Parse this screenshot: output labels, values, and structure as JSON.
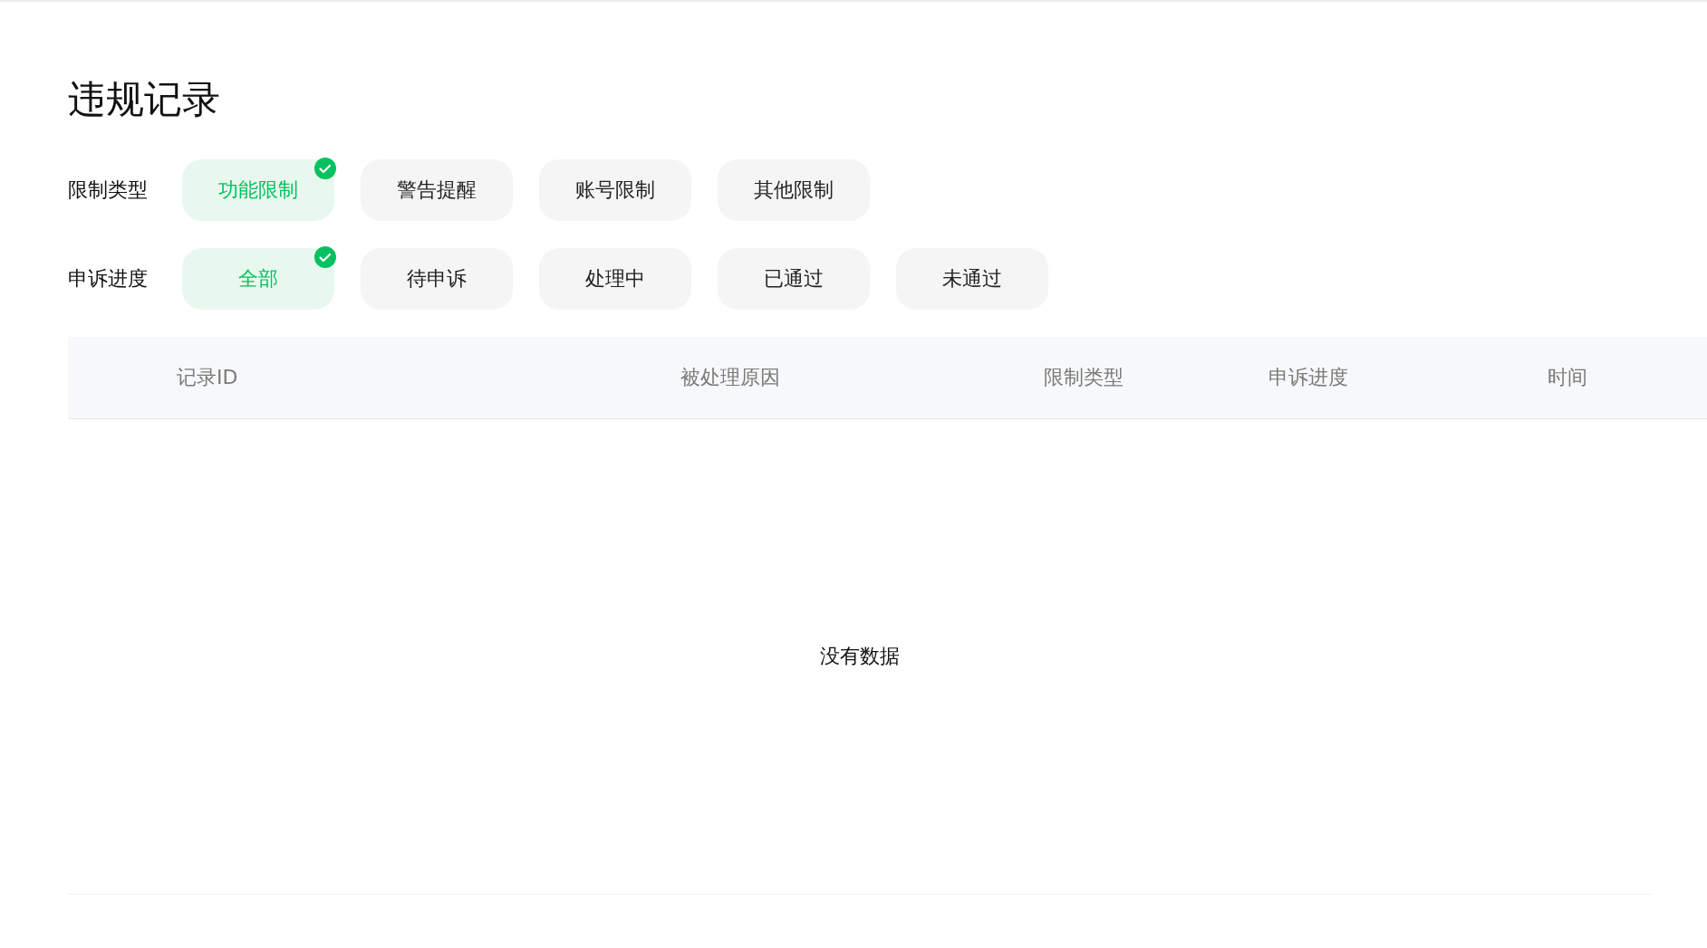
{
  "title": "违规记录",
  "filters": [
    {
      "label": "限制类型",
      "options": [
        {
          "label": "功能限制",
          "selected": true
        },
        {
          "label": "警告提醒",
          "selected": false
        },
        {
          "label": "账号限制",
          "selected": false
        },
        {
          "label": "其他限制",
          "selected": false
        }
      ]
    },
    {
      "label": "申诉进度",
      "options": [
        {
          "label": "全部",
          "selected": true
        },
        {
          "label": "待申诉",
          "selected": false
        },
        {
          "label": "处理中",
          "selected": false
        },
        {
          "label": "已通过",
          "selected": false
        },
        {
          "label": "未通过",
          "selected": false
        }
      ]
    }
  ],
  "table": {
    "columns": [
      "记录ID",
      "被处理原因",
      "限制类型",
      "申诉进度",
      "时间"
    ],
    "empty_text": "没有数据"
  }
}
